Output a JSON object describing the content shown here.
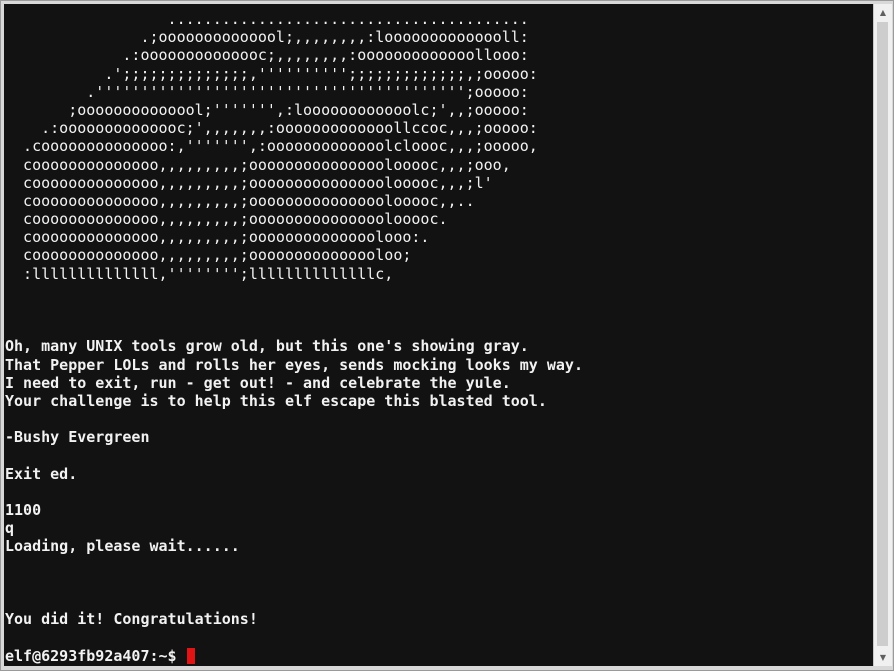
{
  "terminal": {
    "art": [
      "                  ........................................",
      "               .;oooooooooooool;,,,,,,,,:loooooooooooooll:",
      "             .:oooooooooooooc;,,,,,,,,:ooooooooooooollooo:",
      "           .';;;;;;;;;;;;;;,'''''''''';;;;;;;;;;;;;,;ooooo:",
      "         .''''''''''''''''''''''''''''''''''''''''';ooooo:",
      "       ;oooooooooooool;''''''',:loooooooooooolc;',,;ooooo:",
      "    .:oooooooooooooc;',,,,,,,:ooooooooooooollccoc,,,;ooooo:",
      "  .coooooooooooooo:,''''''',:ooooooooooooolcloooc,,,;ooooo,",
      "  coooooooooooooo,,,,,,,,,;ooooooooooooooolooooc,,,;ooo,",
      "  coooooooooooooo,,,,,,,,,;ooooooooooooooolooooc,,,;l'",
      "  coooooooooooooo,,,,,,,,,;ooooooooooooooolooooc,,..",
      "  coooooooooooooo,,,,,,,,,;ooooooooooooooolooooc.",
      "  coooooooooooooo,,,,,,,,,;oooooooooooooolooo:.",
      "  coooooooooooooo,,,,,,,,,;ooooooooooooooloo;",
      "  :llllllllllllll,'''''''';llllllllllllllc,"
    ],
    "poem": [
      "Oh, many UNIX tools grow old, but this one's showing gray.",
      "That Pepper LOLs and rolls her eyes, sends mocking looks my way.",
      "I need to exit, run - get out! - and celebrate the yule.",
      "Your challenge is to help this elf escape this blasted tool."
    ],
    "signature": "-Bushy Evergreen",
    "task": "Exit ed.",
    "output_byte_count": "1100",
    "input_command": "q",
    "loading": "Loading, please wait......",
    "success": "You did it! Congratulations!",
    "prompt": "elf@6293fb92a407:~$ "
  },
  "colors": {
    "terminal_bg": "#121212",
    "terminal_fg": "#f2f2f2",
    "cursor": "#e01414",
    "scrollbar_track": "#f0f0f0",
    "scrollbar_thumb": "#cdcdcd"
  },
  "icons": {
    "scroll_up": "▲",
    "scroll_down": "▼"
  }
}
